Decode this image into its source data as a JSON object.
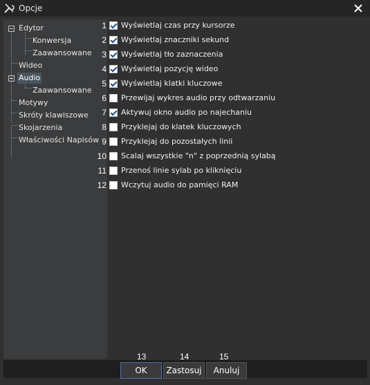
{
  "window": {
    "title": "Opcje"
  },
  "tree": [
    {
      "label": "Edytor"
    },
    {
      "label": "Konwersja"
    },
    {
      "label": "Zaawansowane"
    },
    {
      "label": "Wideo"
    },
    {
      "label": "Audio"
    },
    {
      "label": "Zaawansowane"
    },
    {
      "label": "Motywy"
    },
    {
      "label": "Skróty klawiszowe"
    },
    {
      "label": "Skojarzenia"
    },
    {
      "label": "Właściwości Napisów"
    }
  ],
  "options": [
    {
      "num": "1",
      "label": "Wyświetlaj czas przy kursorze",
      "checked": true
    },
    {
      "num": "2",
      "label": "Wyświetlaj znaczniki sekund",
      "checked": true
    },
    {
      "num": "3",
      "label": "Wyświetlaj tło zaznaczenia",
      "checked": true
    },
    {
      "num": "4",
      "label": "Wyświetlaj pozycję wideo",
      "checked": true
    },
    {
      "num": "5",
      "label": "Wyświetlaj klatki kluczowe",
      "checked": true
    },
    {
      "num": "6",
      "label": "Przewijaj wykres audio przy odtwarzaniu",
      "checked": false
    },
    {
      "num": "7",
      "label": "Aktywuj okno audio po najechaniu",
      "checked": true
    },
    {
      "num": "8",
      "label": "Przyklejaj do klatek kluczowych",
      "checked": false
    },
    {
      "num": "9",
      "label": "Przyklejaj do pozostałych linii",
      "checked": false
    },
    {
      "num": "10",
      "label": "Scalaj wszystkie \"n\" z poprzednią sylabą",
      "checked": false
    },
    {
      "num": "11",
      "label": "Przenoś linie sylab po kliknięciu",
      "checked": false
    },
    {
      "num": "12",
      "label": "Wczytuj audio do pamięci RAM",
      "checked": false
    }
  ],
  "buttons": {
    "ok": {
      "num": "13",
      "label": "OK"
    },
    "apply": {
      "num": "14",
      "label": "Zastosuj"
    },
    "cancel": {
      "num": "15",
      "label": "Anuluj"
    }
  }
}
